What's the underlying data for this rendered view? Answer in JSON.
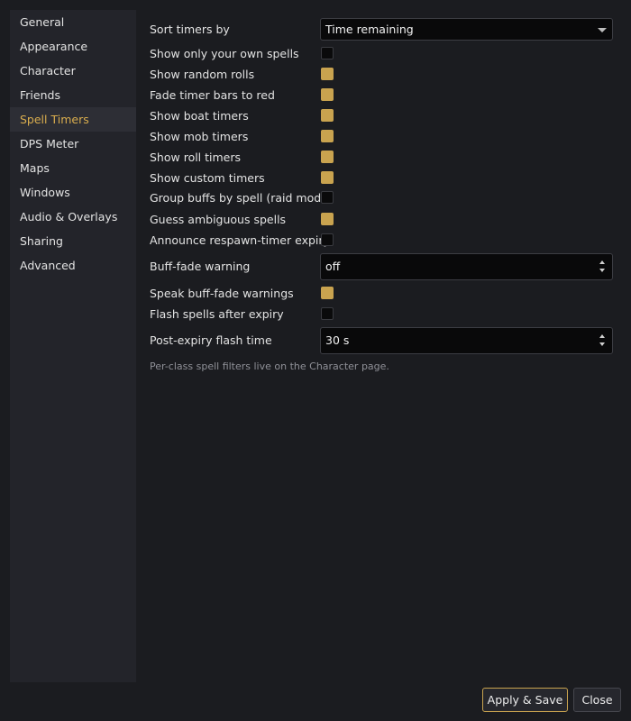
{
  "sidebar": {
    "items": [
      {
        "label": "General"
      },
      {
        "label": "Appearance"
      },
      {
        "label": "Character"
      },
      {
        "label": "Friends"
      },
      {
        "label": "Spell Timers",
        "active": true
      },
      {
        "label": "DPS Meter"
      },
      {
        "label": "Maps"
      },
      {
        "label": "Windows"
      },
      {
        "label": "Audio & Overlays"
      },
      {
        "label": "Sharing"
      },
      {
        "label": "Advanced"
      }
    ]
  },
  "settings": {
    "sort_timers": {
      "label": "Sort timers by",
      "value": "Time remaining"
    },
    "own_spells": {
      "label": "Show only your own spells",
      "checked": false
    },
    "random_rolls": {
      "label": "Show random rolls",
      "checked": true
    },
    "fade_red": {
      "label": "Fade timer bars to red",
      "checked": true
    },
    "boat_timers": {
      "label": "Show boat timers",
      "checked": true
    },
    "mob_timers": {
      "label": "Show mob timers",
      "checked": true
    },
    "roll_timers": {
      "label": "Show roll timers",
      "checked": true
    },
    "custom_timers": {
      "label": "Show custom timers",
      "checked": true
    },
    "group_buffs": {
      "label": "Group buffs by spell (raid mode)",
      "checked": false
    },
    "guess_ambiguous": {
      "label": "Guess ambiguous spells",
      "checked": true
    },
    "announce_respawn": {
      "label": "Announce respawn-timer expiry",
      "checked": false
    },
    "buff_fade_warning": {
      "label": "Buff-fade warning",
      "value": "off"
    },
    "speak_buff_fade": {
      "label": "Speak buff-fade warnings",
      "checked": true
    },
    "flash_after_expiry": {
      "label": "Flash spells after expiry",
      "checked": false
    },
    "post_expiry_flash": {
      "label": "Post-expiry flash time",
      "value": "30 s"
    },
    "hint": "Per-class spell filters live on the Character page."
  },
  "buttons": {
    "apply_save": "Apply & Save",
    "close": "Close"
  },
  "colors": {
    "accent": "#c9a34f",
    "active_nav_text": "#d9ad4e",
    "background": "#1b1c20",
    "sidebar": "#23242a"
  }
}
